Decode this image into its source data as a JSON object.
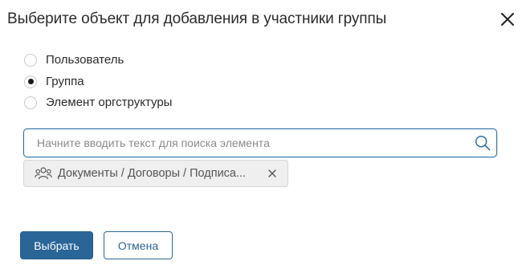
{
  "dialog": {
    "title": "Выберите объект для добавления в участники группы",
    "close_icon": "close-icon"
  },
  "options": [
    {
      "label": "Пользователь",
      "checked": false
    },
    {
      "label": "Группа",
      "checked": true
    },
    {
      "label": "Элемент оргструктуры",
      "checked": false
    }
  ],
  "search": {
    "value": "",
    "placeholder": "Начните вводить текст для поиска элемента",
    "icon": "search-icon"
  },
  "selected_chip": {
    "icon": "group-icon",
    "label": "Документы / Договоры / Подписа...",
    "remove_icon": "remove-icon"
  },
  "actions": {
    "confirm_label": "Выбрать",
    "cancel_label": "Отмена"
  },
  "colors": {
    "primary": "#2a6598",
    "focus_border": "#2f6fa8",
    "chip_bg": "#efefef"
  }
}
